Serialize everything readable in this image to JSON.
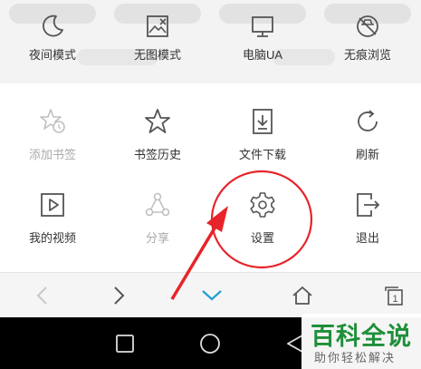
{
  "menu": {
    "row0": [
      {
        "label": "夜间模式",
        "icon": "moon-icon"
      },
      {
        "label": "无图模式",
        "icon": "no-image-icon"
      },
      {
        "label": "电脑UA",
        "icon": "monitor-icon"
      },
      {
        "label": "无痕浏览",
        "icon": "incognito-icon"
      }
    ],
    "row1": [
      {
        "label": "添加书签",
        "icon": "star-clock-icon",
        "disabled": true
      },
      {
        "label": "书签历史",
        "icon": "star-icon"
      },
      {
        "label": "文件下载",
        "icon": "download-icon"
      },
      {
        "label": "刷新",
        "icon": "refresh-icon"
      }
    ],
    "row2": [
      {
        "label": "我的视频",
        "icon": "play-icon"
      },
      {
        "label": "分享",
        "icon": "share-icon",
        "disabled": true
      },
      {
        "label": "设置",
        "icon": "gear-icon"
      },
      {
        "label": "退出",
        "icon": "exit-icon"
      }
    ]
  },
  "navbar": {
    "items": [
      {
        "icon": "back-icon",
        "disabled": true
      },
      {
        "icon": "forward-icon"
      },
      {
        "icon": "collapse-menu-icon",
        "active": true
      },
      {
        "icon": "home-icon"
      },
      {
        "icon": "tabs-icon",
        "count": "1"
      }
    ]
  },
  "system_bar": {
    "items": [
      {
        "icon": "recent-apps-icon"
      },
      {
        "icon": "home-circle-icon"
      },
      {
        "icon": "system-back-icon"
      }
    ]
  },
  "watermark": {
    "title": "百科全说",
    "subtitle": "助你轻松解决"
  },
  "colors": {
    "accent": "#1e9fd4",
    "annotation": "#e8232a",
    "watermark_green": "#1f8f3a",
    "icon": "#555555",
    "icon_disabled": "#c0c0c0"
  }
}
